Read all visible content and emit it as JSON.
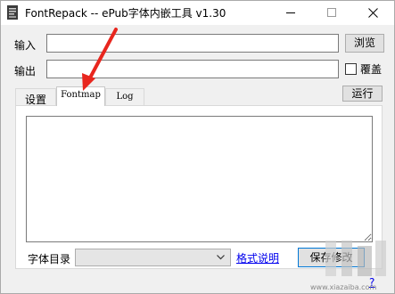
{
  "window": {
    "title": "FontRepack -- ePub字体内嵌工具 v1.30",
    "controls": {
      "minimize": "minimize-icon",
      "maximize": "maximize-icon",
      "close": "close-icon"
    }
  },
  "input_row": {
    "label": "输入",
    "value": "",
    "browse_button": "浏览"
  },
  "output_row": {
    "label": "输出",
    "value": "",
    "overwrite_label": "覆盖",
    "overwrite_checked": false
  },
  "tabs": [
    {
      "label": "设置",
      "active": false
    },
    {
      "label": "Fontmap",
      "active": true
    },
    {
      "label": "Log",
      "active": false
    }
  ],
  "run_button": "运行",
  "fontmap_text": "",
  "bottom": {
    "font_dir_label": "字体目录",
    "font_dir_selected": "",
    "format_link": "格式说明",
    "save_button": "保存修改",
    "help_link": "?"
  },
  "annotation": {
    "arrow_color": "#e8261e"
  },
  "watermark": {
    "text": "www.xiazaiba.com"
  }
}
